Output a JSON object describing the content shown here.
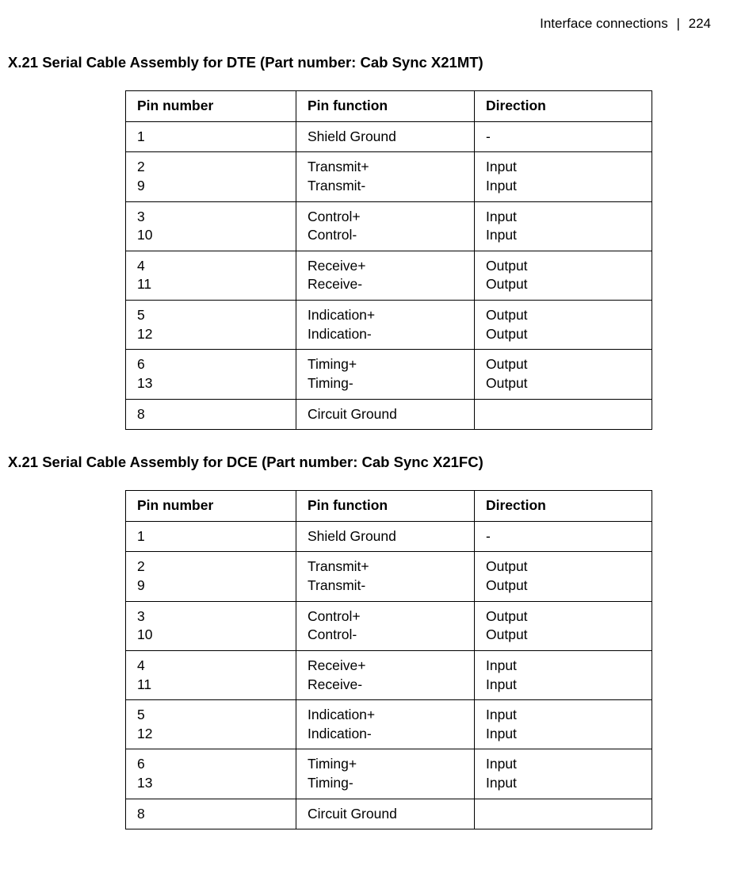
{
  "header": {
    "section": "Interface connections",
    "page_number": "224"
  },
  "sections": [
    {
      "heading": "X.21 Serial Cable Assembly for DTE (Part number: Cab Sync X21MT)",
      "name": "dte-section",
      "columns": [
        "Pin number",
        "Pin function",
        "Direction"
      ],
      "rows": [
        {
          "pins": [
            "1"
          ],
          "funcs": [
            "Shield Ground"
          ],
          "dirs": [
            "-"
          ]
        },
        {
          "pins": [
            "2",
            "9"
          ],
          "funcs": [
            "Transmit+",
            "Transmit-"
          ],
          "dirs": [
            "Input",
            "Input"
          ]
        },
        {
          "pins": [
            "3",
            "10"
          ],
          "funcs": [
            "Control+",
            "Control-"
          ],
          "dirs": [
            "Input",
            "Input"
          ]
        },
        {
          "pins": [
            "4",
            "11"
          ],
          "funcs": [
            "Receive+",
            "Receive-"
          ],
          "dirs": [
            "Output",
            "Output"
          ]
        },
        {
          "pins": [
            "5",
            "12"
          ],
          "funcs": [
            "Indication+",
            "Indication-"
          ],
          "dirs": [
            "Output",
            "Output"
          ]
        },
        {
          "pins": [
            "6",
            "13"
          ],
          "funcs": [
            "Timing+",
            "Timing-"
          ],
          "dirs": [
            "Output",
            "Output"
          ]
        },
        {
          "pins": [
            "8"
          ],
          "funcs": [
            "Circuit Ground"
          ],
          "dirs": [
            ""
          ]
        }
      ]
    },
    {
      "heading": "X.21 Serial Cable Assembly for DCE (Part number: Cab Sync X21FC)",
      "name": "dce-section",
      "columns": [
        "Pin number",
        "Pin function",
        "Direction"
      ],
      "rows": [
        {
          "pins": [
            "1"
          ],
          "funcs": [
            "Shield Ground"
          ],
          "dirs": [
            "-"
          ]
        },
        {
          "pins": [
            "2",
            "9"
          ],
          "funcs": [
            "Transmit+",
            "Transmit-"
          ],
          "dirs": [
            "Output",
            "Output"
          ]
        },
        {
          "pins": [
            "3",
            "10"
          ],
          "funcs": [
            "Control+",
            "Control-"
          ],
          "dirs": [
            "Output",
            "Output"
          ]
        },
        {
          "pins": [
            "4",
            "11"
          ],
          "funcs": [
            "Receive+",
            "Receive-"
          ],
          "dirs": [
            "Input",
            "Input"
          ]
        },
        {
          "pins": [
            "5",
            "12"
          ],
          "funcs": [
            "Indication+",
            "Indication-"
          ],
          "dirs": [
            "Input",
            "Input"
          ]
        },
        {
          "pins": [
            "6",
            "13"
          ],
          "funcs": [
            "Timing+",
            "Timing-"
          ],
          "dirs": [
            "Input",
            "Input"
          ]
        },
        {
          "pins": [
            "8"
          ],
          "funcs": [
            "Circuit Ground"
          ],
          "dirs": [
            ""
          ]
        }
      ]
    }
  ]
}
